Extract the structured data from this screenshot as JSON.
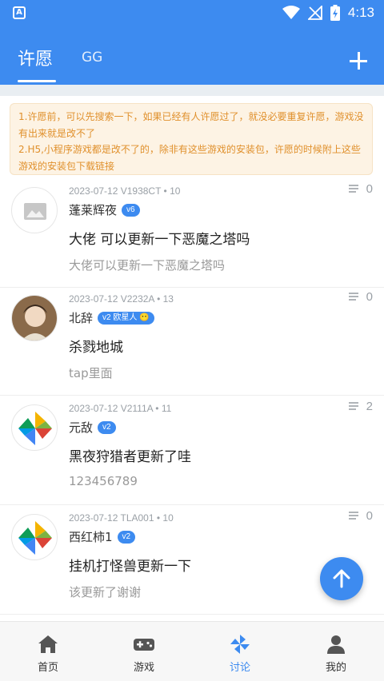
{
  "status_bar": {
    "time": "4:13",
    "app_badge": "A"
  },
  "header": {
    "tabs": [
      {
        "label": "许愿"
      },
      {
        "label": "GG"
      }
    ]
  },
  "notice": {
    "line1": "1.许愿前，可以先搜索一下，如果已经有人许愿过了，就没必要重复许愿，游戏没有出来就是改不了",
    "line2": "2.H5,小程序游戏都是改不了的，除非有这些游戏的安装包，许愿的时候附上这些游戏的安装包下载链接"
  },
  "posts": [
    {
      "meta": "2023-07-12 V1938CT • 10",
      "username": "蓬莱辉夜",
      "badge": "v6",
      "title": "大佬 可以更新一下恶魔之塔吗",
      "body": "大佬可以更新一下恶魔之塔吗",
      "count": "0"
    },
    {
      "meta": "2023-07-12 V2232A • 13",
      "username": "北辞",
      "badge": "v2 欧星人 😶",
      "title": "杀戮地城",
      "body": "tap里面",
      "count": "0"
    },
    {
      "meta": "2023-07-12 V2111A • 11",
      "username": "元敌",
      "badge": "v2",
      "title": "黑夜狩猎者更新了哇",
      "body": "123456789",
      "count": "2"
    },
    {
      "meta": "2023-07-12 TLA001 • 10",
      "username": "西红柿1",
      "badge": "v2",
      "title": "挂机打怪兽更新一下",
      "body": "该更新了谢谢",
      "count": "0"
    }
  ],
  "bottom_nav": [
    {
      "label": "首页",
      "icon": "home-icon"
    },
    {
      "label": "游戏",
      "icon": "gamepad-icon"
    },
    {
      "label": "讨论",
      "icon": "pinwheel-icon"
    },
    {
      "label": "我的",
      "icon": "person-icon"
    }
  ],
  "colors": {
    "primary": "#3d8bf0",
    "notice_text": "#e0902c",
    "notice_bg": "#fdf3e4"
  }
}
